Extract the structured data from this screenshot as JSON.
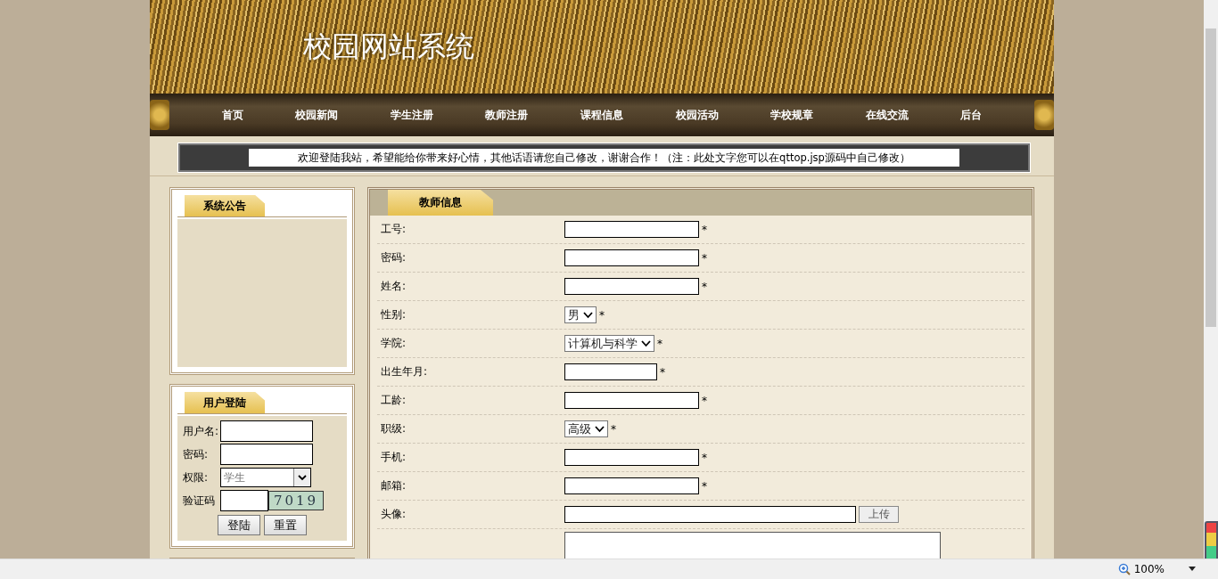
{
  "site_title": "校园网站系统",
  "nav": [
    {
      "label": "首页"
    },
    {
      "label": "校园新闻"
    },
    {
      "label": "学生注册"
    },
    {
      "label": "教师注册"
    },
    {
      "label": "课程信息"
    },
    {
      "label": "校园活动"
    },
    {
      "label": "学校规章"
    },
    {
      "label": "在线交流"
    },
    {
      "label": "后台"
    }
  ],
  "marquee": "欢迎登陆我站，希望能给你带来好心情，其他话语请您自己修改，谢谢合作！（注：此处文字您可以在qttop.jsp源码中自己修改）",
  "notice_panel": {
    "title": "系统公告"
  },
  "login_panel": {
    "title": "用户登陆",
    "fields": [
      {
        "kind": "text",
        "label": "用户名:"
      },
      {
        "kind": "password",
        "label": "密码:"
      },
      {
        "kind": "select",
        "label": "权限:",
        "value": "学生"
      },
      {
        "kind": "captcha",
        "label": "验证码",
        "code": "7019"
      }
    ],
    "buttons": [
      "登陆",
      "重置"
    ]
  },
  "form": {
    "title": "教师信息",
    "rows": [
      {
        "kind": "text",
        "label": "工号:",
        "mark": "*"
      },
      {
        "kind": "text",
        "label": "密码:",
        "mark": "*"
      },
      {
        "kind": "text",
        "label": "姓名:",
        "mark": "*"
      },
      {
        "kind": "select",
        "label": "性别:",
        "value": "男",
        "mark": "*"
      },
      {
        "kind": "select",
        "label": "学院:",
        "value": "计算机与科学",
        "mark": "*"
      },
      {
        "kind": "date",
        "label": "出生年月:",
        "mark": "*"
      },
      {
        "kind": "text",
        "label": "工龄:",
        "mark": "*"
      },
      {
        "kind": "select",
        "label": "职级:",
        "value": "高级",
        "mark": "*"
      },
      {
        "kind": "text",
        "label": "手机:",
        "mark": "*"
      },
      {
        "kind": "text",
        "label": "邮箱:",
        "mark": "*"
      },
      {
        "kind": "file",
        "label": "头像:",
        "button": "上传"
      },
      {
        "kind": "textarea"
      }
    ]
  },
  "status_bar": {
    "zoom": "100%"
  }
}
